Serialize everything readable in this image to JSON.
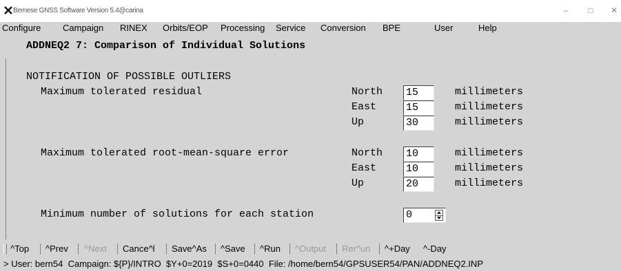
{
  "window": {
    "title": "Bernese GNSS Software Version 5.4@carina",
    "min_glyph": "–",
    "max_glyph": "□",
    "close_glyph": "✕",
    "icon": "bernese-x-icon"
  },
  "menu": [
    {
      "label": "Configure"
    },
    {
      "label": "Campaign"
    },
    {
      "label": "RINEX"
    },
    {
      "label": "Orbits/EOP"
    },
    {
      "label": "Processing"
    },
    {
      "label": "Service"
    },
    {
      "label": "Conversion"
    },
    {
      "label": "BPE"
    },
    {
      "label": "User"
    },
    {
      "label": "Help"
    }
  ],
  "panel": {
    "heading": "ADDNEQ2 7: Comparison of Individual Solutions",
    "section": "NOTIFICATION OF POSSIBLE OUTLIERS",
    "residual": {
      "label": "Maximum tolerated residual",
      "rows": [
        {
          "axis": "North",
          "value": "15",
          "unit": "millimeters"
        },
        {
          "axis": "East",
          "value": "15",
          "unit": "millimeters"
        },
        {
          "axis": "Up",
          "value": "30",
          "unit": "millimeters"
        }
      ]
    },
    "rms": {
      "label": "Maximum tolerated root-mean-square error",
      "rows": [
        {
          "axis": "North",
          "value": "10",
          "unit": "millimeters"
        },
        {
          "axis": "East",
          "value": "10",
          "unit": "millimeters"
        },
        {
          "axis": "Up",
          "value": "20",
          "unit": "millimeters"
        }
      ]
    },
    "min_solutions": {
      "label": "Minimum number of solutions for each station",
      "value": "0"
    }
  },
  "toolbar": [
    {
      "label": "^Top",
      "enabled": true
    },
    {
      "label": "^Prev",
      "enabled": true
    },
    {
      "label": "^Next",
      "enabled": false
    },
    {
      "label": "Cance^l",
      "enabled": true
    },
    {
      "label": "Save^As",
      "enabled": true
    },
    {
      "label": "^Save",
      "enabled": true
    },
    {
      "label": "^Run",
      "enabled": true
    },
    {
      "label": "^Output",
      "enabled": false
    },
    {
      "label": "Rer^un",
      "enabled": false
    },
    {
      "label": "^+Day",
      "enabled": true
    },
    {
      "label": "^-Day",
      "enabled": true
    }
  ],
  "status": "> User: bern54  Campaign: ${P}/INTRO  $Y+0=2019  $S+0=0440  File: /home/bern54/GPSUSER54/PAN/ADDNEQ2.INP"
}
